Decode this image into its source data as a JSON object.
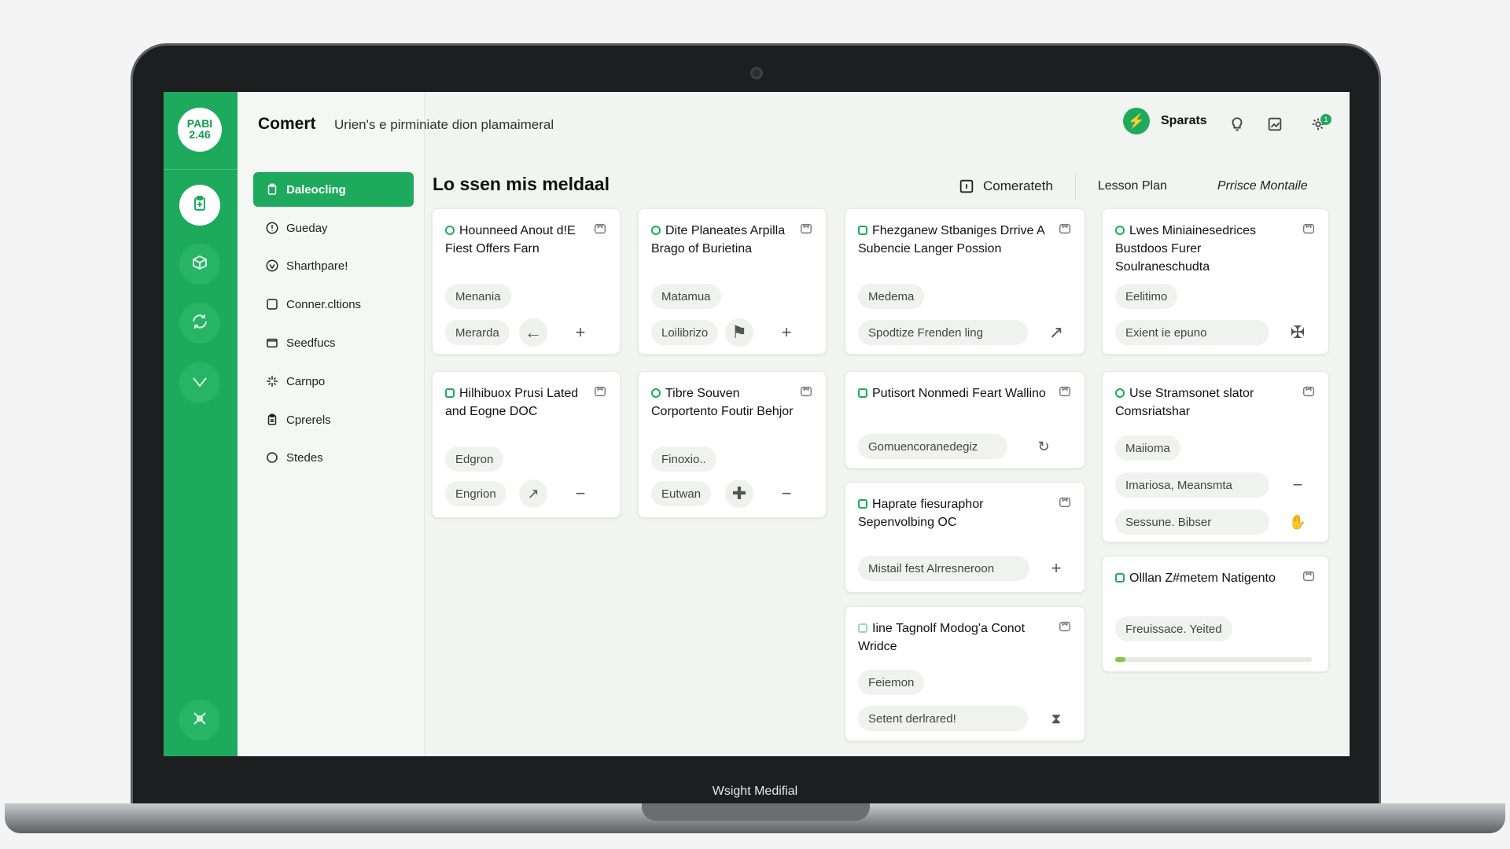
{
  "app": {
    "logo": "PABI 2.46",
    "title": "Comert",
    "subtitle": "Urien's e pirminiate dion plamaimeral",
    "user": "Sparats",
    "notification_count": "1"
  },
  "laptop_label": "Wsight Medifial",
  "rail": {
    "icons": [
      "clipboard-icon",
      "box-icon",
      "sync-icon",
      "check-icon",
      "tools-icon"
    ]
  },
  "nav": {
    "items": [
      {
        "label": "Daleocling",
        "icon": "clipboard-icon"
      },
      {
        "label": "Gueday",
        "icon": "info-icon"
      },
      {
        "label": "Sharthpare!",
        "icon": "shield-icon"
      },
      {
        "label": "Conner.cltions",
        "icon": "square-icon"
      },
      {
        "label": "Seedfucs",
        "icon": "folder-icon"
      },
      {
        "label": "Carnpo",
        "icon": "sparkle-icon"
      },
      {
        "label": "Cprerels",
        "icon": "clipboard-icon"
      },
      {
        "label": "Stedes",
        "icon": "circle-icon"
      }
    ]
  },
  "main": {
    "title": "Lo ssen mis meldaal",
    "tabs": [
      "Comerateth",
      "Lesson Plan",
      "Prrisce Montaile"
    ]
  },
  "cards": {
    "c1": {
      "title": "Hounneed Anout d!E Fiest Offers Farn",
      "tag": "Menania",
      "chip": "Merarda"
    },
    "c2": {
      "title": "Dite Planeates Arpilla Brago of Burietina",
      "tag": "Matamua",
      "chip": "Loilibrizo"
    },
    "c3": {
      "title": "Fhezganew Stbaniges Drrive A Subencie Langer Possion",
      "tag": "Medema",
      "chip": "Spodtize Frenden ling"
    },
    "c4": {
      "title": "Lwes Miniainesedrices Bustdoos Furer Soulraneschudta",
      "tag": "Eelitimo",
      "chip": "Exient ie epuno"
    },
    "c5": {
      "title": "Hilhibuox Prusi Lated and Eogne DOC",
      "tag": "Edgron",
      "chip": "Engrion"
    },
    "c6": {
      "title": "Tibre Souven Corportento Foutir Behjor",
      "tag": "Finoxio..",
      "chip": "Eutwan"
    },
    "c7": {
      "title": "Putisort Nonmedi Feart Wallino",
      "chip": "Gomuencoranedegiz"
    },
    "c8": {
      "title": "Use Stramsonet slator Comsriatshar",
      "tag": "Maiioma",
      "chip": "Imariosa, Meansmta",
      "chip2": "Sessune. Bibser"
    },
    "c9": {
      "title": "Haprate fiesuraphor Sepenvolbing OC",
      "chip": "Mistail fest Alrresneroon"
    },
    "c10": {
      "title": "Olllan Z#metem Natigento",
      "tag": "Freuissace. Yeited",
      "progress": 0.05
    },
    "c11": {
      "title": "Iine Tagnolf Modog'a Conot Wridce",
      "tag": "Feiemon",
      "chip": "Setent derlrared!"
    }
  },
  "colors": {
    "accent": "#1eaa5d",
    "progress": "#8bc34a"
  }
}
